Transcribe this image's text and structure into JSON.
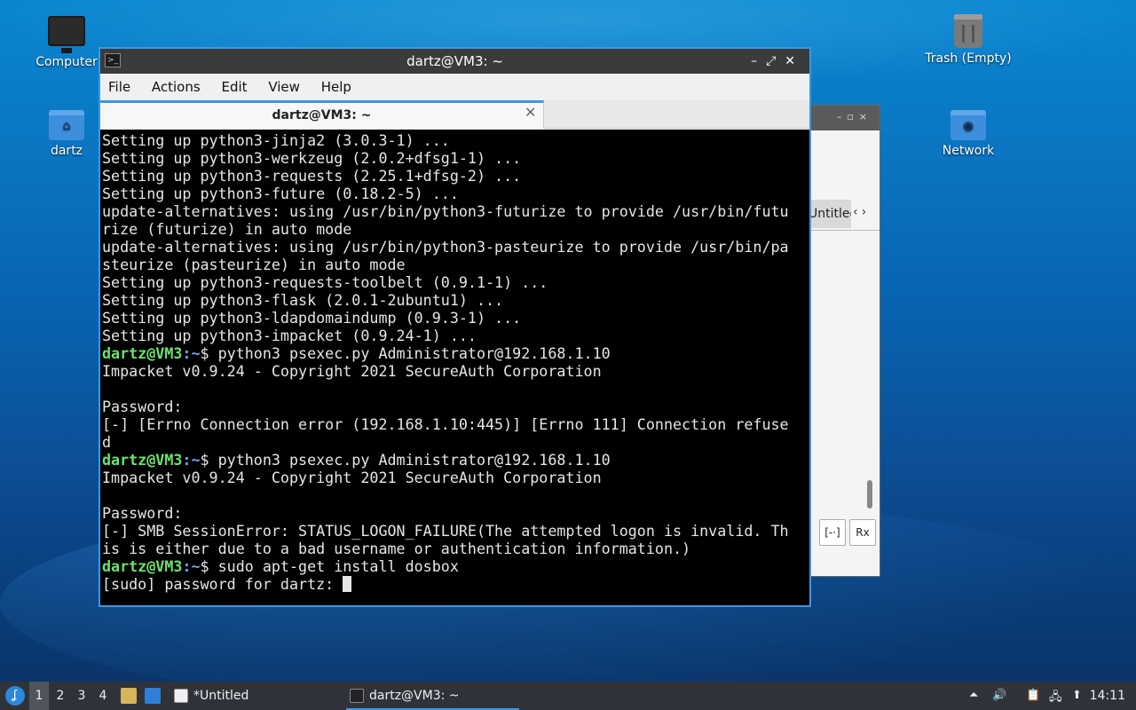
{
  "desktop": {
    "icons": [
      {
        "label": "Computer"
      },
      {
        "label": "dartz"
      },
      {
        "label": "Trash (Empty)"
      },
      {
        "label": "Network"
      }
    ]
  },
  "background_window": {
    "tab_label": "Untitled",
    "btn1": "[-·]",
    "btn2": "Rx"
  },
  "terminal": {
    "title": "dartz@VM3: ~",
    "menu": [
      "File",
      "Actions",
      "Edit",
      "View",
      "Help"
    ],
    "tab_label": "dartz@VM3: ~",
    "prompt_user": "dartz@VM3",
    "prompt_path": ":~",
    "lines": [
      {
        "type": "out",
        "text": "Setting up python3-jinja2 (3.0.3-1) ..."
      },
      {
        "type": "out",
        "text": "Setting up python3-werkzeug (2.0.2+dfsg1-1) ..."
      },
      {
        "type": "out",
        "text": "Setting up python3-requests (2.25.1+dfsg-2) ..."
      },
      {
        "type": "out",
        "text": "Setting up python3-future (0.18.2-5) ..."
      },
      {
        "type": "out",
        "text": "update-alternatives: using /usr/bin/python3-futurize to provide /usr/bin/futu"
      },
      {
        "type": "out",
        "text": "rize (futurize) in auto mode"
      },
      {
        "type": "out",
        "text": "update-alternatives: using /usr/bin/python3-pasteurize to provide /usr/bin/pa"
      },
      {
        "type": "out",
        "text": "steurize (pasteurize) in auto mode"
      },
      {
        "type": "out",
        "text": "Setting up python3-requests-toolbelt (0.9.1-1) ..."
      },
      {
        "type": "out",
        "text": "Setting up python3-flask (2.0.1-2ubuntu1) ..."
      },
      {
        "type": "out",
        "text": "Setting up python3-ldapdomaindump (0.9.3-1) ..."
      },
      {
        "type": "out",
        "text": "Setting up python3-impacket (0.9.24-1) ..."
      },
      {
        "type": "cmd",
        "text": "$ python3 psexec.py Administrator@192.168.1.10"
      },
      {
        "type": "out",
        "text": "Impacket v0.9.24 - Copyright 2021 SecureAuth Corporation"
      },
      {
        "type": "out",
        "text": ""
      },
      {
        "type": "out",
        "text": "Password:"
      },
      {
        "type": "out",
        "text": "[-] [Errno Connection error (192.168.1.10:445)] [Errno 111] Connection refuse"
      },
      {
        "type": "out",
        "text": "d"
      },
      {
        "type": "cmd",
        "text": "$ python3 psexec.py Administrator@192.168.1.10"
      },
      {
        "type": "out",
        "text": "Impacket v0.9.24 - Copyright 2021 SecureAuth Corporation"
      },
      {
        "type": "out",
        "text": ""
      },
      {
        "type": "out",
        "text": "Password:"
      },
      {
        "type": "out",
        "text": "[-] SMB SessionError: STATUS_LOGON_FAILURE(The attempted logon is invalid. Th"
      },
      {
        "type": "out",
        "text": "is is either due to a bad username or authentication information.)"
      },
      {
        "type": "cmd",
        "text": "$ sudo apt-get install dosbox"
      },
      {
        "type": "cursor",
        "text": "[sudo] password for dartz: "
      }
    ]
  },
  "taskbar": {
    "workspaces": [
      "1",
      "2",
      "3",
      "4"
    ],
    "tasks": [
      {
        "label": "*Untitled"
      },
      {
        "label": "dartz@VM3: ~"
      }
    ],
    "clock": "14:11",
    "colors": {
      "accent": "#3d98e6",
      "prompt": "#6be36b",
      "path": "#6aa7ff"
    }
  }
}
